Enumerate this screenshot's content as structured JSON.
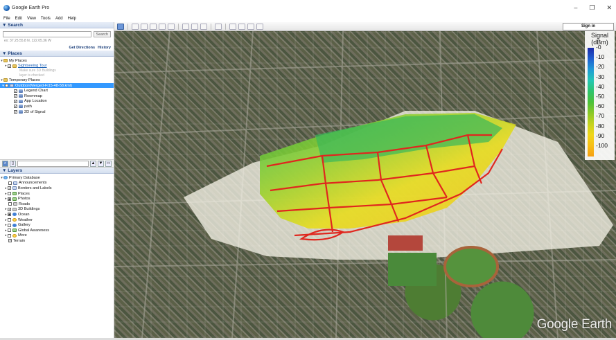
{
  "window": {
    "title": "Google Earth Pro",
    "controls": {
      "minimize": "–",
      "maximize": "❐",
      "close": "✕"
    }
  },
  "menu": [
    "File",
    "Edit",
    "View",
    "Tools",
    "Add",
    "Help"
  ],
  "search": {
    "header": "▼ Search",
    "button": "Search",
    "hint": "ex: 37.25.55.8 N, 122.05.36 W",
    "links": [
      "Get Directions",
      "History"
    ]
  },
  "places": {
    "header": "▼ Places",
    "my_places": "My Places",
    "sightseeing": "Sightseeing Tour",
    "sightseeing_sub1": "Make sure 3D Buildings",
    "sightseeing_sub2": "layer is checked",
    "temporary": "Temporary Places",
    "kml": "Outdoor(Merged-Fi15-48-58.kml)",
    "items": [
      "Legend Chart",
      "Roommap",
      "App Location",
      "path",
      "2D of Signal"
    ]
  },
  "layers": {
    "header": "▼ Layers",
    "items": [
      "Primary Database",
      "Announcements",
      "Borders and Labels",
      "Places",
      "Photos",
      "Roads",
      "3D Buildings",
      "Ocean",
      "Weather",
      "Gallery",
      "Global Awareness",
      "More",
      "Terrain"
    ]
  },
  "toolbar": {
    "sign_in": "Sign in"
  },
  "legend": {
    "title_line1": "Signal",
    "title_line2": "(dBm)",
    "ticks": [
      "-0",
      "-10",
      "-20",
      "-30",
      "-40",
      "-50",
      "-60",
      "-70",
      "-80",
      "-90",
      "-100"
    ],
    "colors": [
      "#1c2aa8",
      "#1f5fd0",
      "#1f9bd6",
      "#24c7b4",
      "#2ec46d",
      "#4bc13a",
      "#8ac827",
      "#c4d21f",
      "#f0d61a",
      "#f7bf16",
      "#f59f12"
    ]
  },
  "watermark": "Google Earth"
}
